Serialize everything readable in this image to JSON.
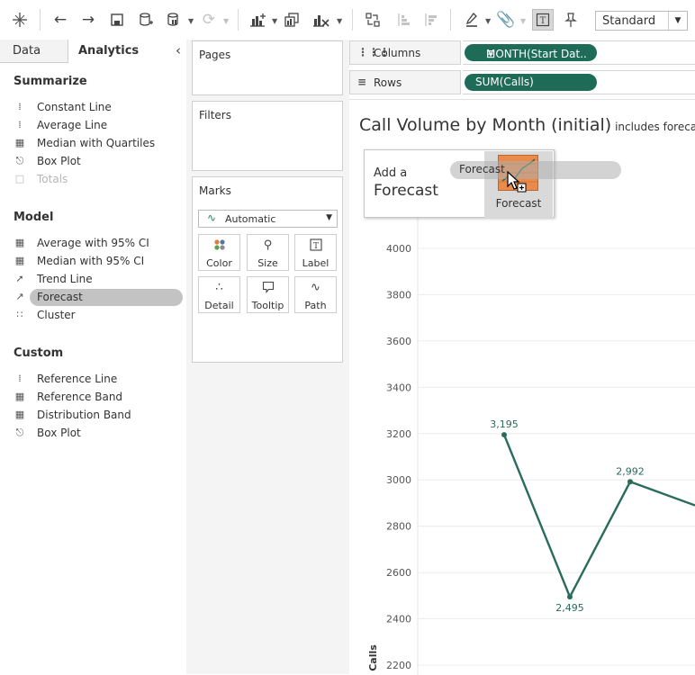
{
  "toolbar": {
    "view_size": "Standard",
    "icons": [
      "tableau-icon",
      "undo-icon",
      "redo-icon",
      "save-icon",
      "new-datasource-icon",
      "pause-updates-icon",
      "refresh-icon",
      "new-worksheet-icon",
      "duplicate-sheet-icon",
      "clear-sheet-icon",
      "swap-rows-columns-icon",
      "sort-ascending-icon",
      "sort-descending-icon",
      "highlight-icon",
      "group-members-icon",
      "show-mark-labels-icon",
      "fix-axes-icon"
    ]
  },
  "left_pane": {
    "tabs": {
      "data": "Data",
      "analytics": "Analytics",
      "collapse": "‹"
    },
    "sections": [
      {
        "title": "Summarize",
        "items": [
          {
            "label": "Constant Line",
            "icon": "constant-line-icon"
          },
          {
            "label": "Average Line",
            "icon": "average-line-icon"
          },
          {
            "label": "Median with Quartiles",
            "icon": "median-quartiles-icon"
          },
          {
            "label": "Box Plot",
            "icon": "box-plot-icon"
          },
          {
            "label": "Totals",
            "icon": "totals-icon",
            "disabled": true
          }
        ]
      },
      {
        "title": "Model",
        "items": [
          {
            "label": "Average with 95% CI",
            "icon": "average-ci-icon"
          },
          {
            "label": "Median with 95% CI",
            "icon": "median-ci-icon"
          },
          {
            "label": "Trend Line",
            "icon": "trend-line-icon"
          },
          {
            "label": "Forecast",
            "icon": "forecast-icon",
            "selected": true
          },
          {
            "label": "Cluster",
            "icon": "cluster-icon"
          }
        ]
      },
      {
        "title": "Custom",
        "items": [
          {
            "label": "Reference Line",
            "icon": "reference-line-icon"
          },
          {
            "label": "Reference Band",
            "icon": "reference-band-icon"
          },
          {
            "label": "Distribution Band",
            "icon": "distribution-band-icon"
          },
          {
            "label": "Box Plot",
            "icon": "box-plot-icon"
          }
        ]
      }
    ]
  },
  "cards": {
    "pages": "Pages",
    "filters": "Filters",
    "marks": "Marks",
    "mark_type": "Automatic",
    "mark_buttons": [
      "Color",
      "Size",
      "Label",
      "Detail",
      "Tooltip",
      "Path"
    ]
  },
  "shelves": {
    "columns_label": "Columns",
    "columns_pill": "MONTH(Start Dat..",
    "rows_label": "Rows",
    "rows_pill": "SUM(Calls)"
  },
  "view": {
    "title": "Call Volume by Month (initial)",
    "subtitle": "includes foreca"
  },
  "drop_target": {
    "line1": "Add a",
    "line2": "Forecast",
    "tile_caption": "Forecast",
    "drag_pill": "Forecast"
  },
  "chart_data": {
    "type": "line",
    "title": "",
    "xlabel": "",
    "ylabel": "Calls",
    "yticks": [
      2200,
      2400,
      2600,
      2800,
      3000,
      3200,
      3400,
      3600,
      3800,
      4000
    ],
    "ylim": [
      2200,
      4100
    ],
    "series": [
      {
        "values": [
          3195,
          2495,
          2992,
          2890
        ],
        "labels": [
          "3,195",
          "2,495",
          "2,992",
          ""
        ]
      }
    ],
    "line_color": "#2a6b5b",
    "grid": true
  }
}
